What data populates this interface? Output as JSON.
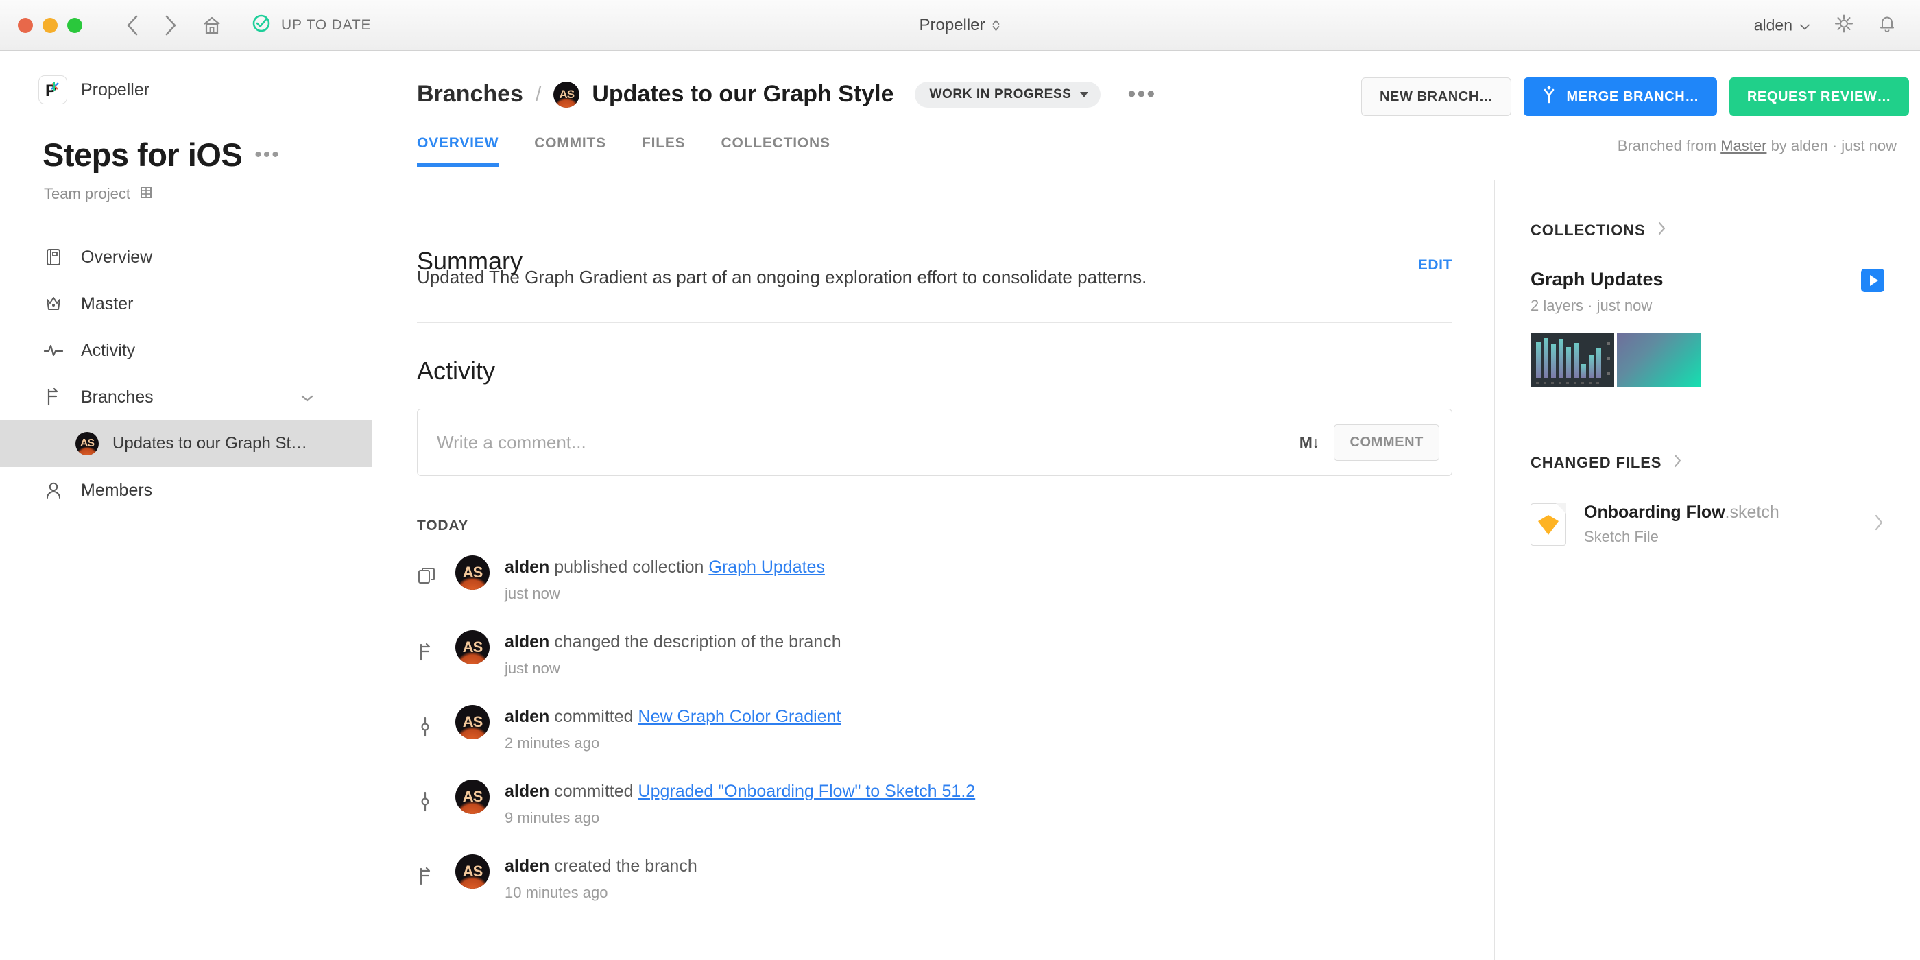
{
  "titlebar": {
    "status_label": "UP TO DATE",
    "window_title": "Propeller",
    "user": "alden",
    "icons": [
      "back-icon",
      "forward-icon",
      "home-icon",
      "check-circle-icon",
      "gear-icon",
      "bell-icon"
    ]
  },
  "sidebar": {
    "brand": "Propeller",
    "project_title": "Steps for iOS",
    "project_menu": "•••",
    "project_subtitle": "Team project",
    "items": [
      {
        "label": "Overview",
        "icon": "document-icon"
      },
      {
        "label": "Master",
        "icon": "crown-icon"
      },
      {
        "label": "Activity",
        "icon": "pulse-icon"
      },
      {
        "label": "Branches",
        "icon": "branch-icon"
      },
      {
        "label": "Updates to our Graph St…",
        "icon": "avatar"
      },
      {
        "label": "Members",
        "icon": "person-icon"
      }
    ]
  },
  "header": {
    "breadcrumb_root": "Branches",
    "breadcrumb_sep": "/",
    "breadcrumb_current": "Updates to our Graph Style",
    "status_badge": "WORK IN PROGRESS",
    "overflow_menu": "•••",
    "buttons": {
      "new_branch": "NEW BRANCH…",
      "merge_branch": "MERGE BRANCH…",
      "request_review": "REQUEST REVIEW…"
    },
    "tabs": [
      {
        "label": "OVERVIEW",
        "active": true
      },
      {
        "label": "COMMITS",
        "active": false
      },
      {
        "label": "FILES",
        "active": false
      },
      {
        "label": "COLLECTIONS",
        "active": false
      }
    ],
    "branched_from_prefix": "Branched from",
    "branched_from_link": "Master",
    "branched_from_suffix": "by alden · just now"
  },
  "summary": {
    "heading": "Summary",
    "edit_label": "EDIT",
    "body": "Updated The Graph Gradient as part of an ongoing exploration effort to consolidate patterns."
  },
  "activity": {
    "heading": "Activity",
    "comment_placeholder": "Write a comment...",
    "markdown_icon": "M↓",
    "comment_button": "COMMENT",
    "day_label": "TODAY",
    "items": [
      {
        "icon": "collection-icon",
        "avatar_initials": "AS",
        "actor": "alden",
        "text": "published collection",
        "link": "Graph Updates",
        "time": "just now"
      },
      {
        "icon": "branch-icon",
        "avatar_initials": "AS",
        "actor": "alden",
        "text": "changed the description of the branch",
        "link": "",
        "time": "just now"
      },
      {
        "icon": "commit-icon",
        "avatar_initials": "AS",
        "actor": "alden",
        "text": "committed",
        "link": "New Graph Color Gradient",
        "time": "2 minutes ago"
      },
      {
        "icon": "commit-icon",
        "avatar_initials": "AS",
        "actor": "alden",
        "text": "committed",
        "link": "Upgraded \"Onboarding Flow\" to Sketch 51.2",
        "time": "9 minutes ago"
      },
      {
        "icon": "branch-icon",
        "avatar_initials": "AS",
        "actor": "alden",
        "text": "created the branch",
        "link": "",
        "time": "10 minutes ago"
      }
    ]
  },
  "collections_panel": {
    "heading": "COLLECTIONS",
    "item_name": "Graph Updates",
    "item_meta": "2 layers · just now",
    "play_icon": "play-icon"
  },
  "changed_files_panel": {
    "heading": "CHANGED FILES",
    "file_name": "Onboarding Flow",
    "file_ext": ".sketch",
    "file_type": "Sketch File"
  },
  "colors": {
    "accent_blue": "#1f86f9",
    "accent_green": "#20d08a",
    "link_blue": "#2d7ff0",
    "tab_active": "#2d88f3",
    "status_green": "#1ecf9a"
  }
}
